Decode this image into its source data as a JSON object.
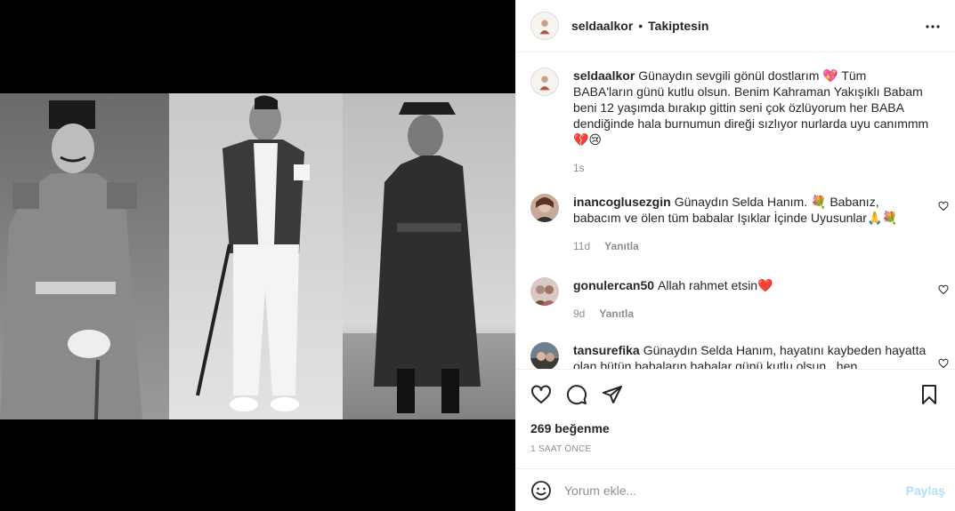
{
  "header": {
    "username": "seldaalkor",
    "separator": "•",
    "follow_status": "Takiptesin"
  },
  "caption": {
    "username": "seldaalkor",
    "text": "Günaydın sevgili gönül dostlarım 💖 Tüm BABA'ların günü kutlu olsun. Benim Kahraman Yakışıklı Babam beni 12 yaşımda bırakıp gittin seni çok özlüyorum her BABA dendiğinde hala burnumun direği sızlıyor nurlarda uyu canımmm 💔😢",
    "time": "1s"
  },
  "comments": [
    {
      "username": "inancoglusezgin",
      "text": "Günaydın Selda Hanım. 💐 Babanız, babacım ve ölen tüm babalar Işıklar İçinde Uyusunlar🙏💐",
      "time": "11d",
      "reply": "Yanıtla"
    },
    {
      "username": "gonulercan50",
      "text": "Allah rahmet etsin❤️",
      "time": "9d",
      "reply": "Yanıtla"
    },
    {
      "username": "tansurefika",
      "text": "Günaydın Selda Hanım, hayatını kaybeden hayatta olan bütün babaların babalar günü kutlu olsun , hep",
      "time": "",
      "reply": ""
    }
  ],
  "stats": {
    "likes": "269 beğenme",
    "posted": "1 SAAT ÖNCE"
  },
  "add_comment": {
    "placeholder": "Yorum ekle...",
    "post_label": "Paylaş"
  },
  "colors": {
    "text": "#262626",
    "muted": "#8e8e8e",
    "border": "#efefef",
    "post_disabled": "#b2dffc"
  }
}
